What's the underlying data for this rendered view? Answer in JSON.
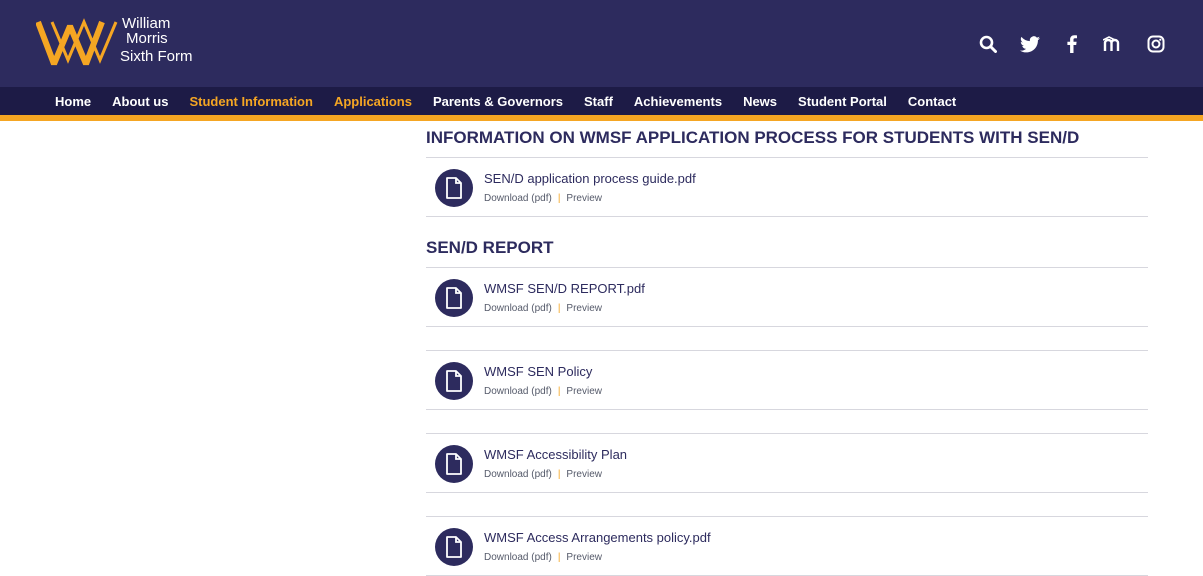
{
  "header": {
    "logo": {
      "line1": "William",
      "line2": "Morris",
      "line3": "Sixth Form"
    },
    "social": [
      "search-icon",
      "twitter-icon",
      "facebook-icon",
      "moodle-icon",
      "instagram-icon"
    ]
  },
  "nav": {
    "items": [
      {
        "label": "Home"
      },
      {
        "label": "About us"
      },
      {
        "label": "Student Information"
      },
      {
        "label": "Applications"
      },
      {
        "label": "Parents & Governors"
      },
      {
        "label": "Staff"
      },
      {
        "label": "Achievements"
      },
      {
        "label": "News"
      },
      {
        "label": "Student Portal"
      },
      {
        "label": "Contact"
      }
    ]
  },
  "sections": [
    {
      "title": "INFORMATION ON WMSF APPLICATION PROCESS FOR STUDENTS WITH SEN/D",
      "files": [
        {
          "name": "SEN/D application process guide.pdf",
          "download": "Download (pdf)",
          "preview": "Preview"
        }
      ]
    },
    {
      "title": "SEN/D REPORT",
      "files": [
        {
          "name": "WMSF SEN/D REPORT.pdf",
          "download": "Download (pdf)",
          "preview": "Preview"
        },
        {
          "name": "WMSF SEN Policy",
          "download": "Download (pdf)",
          "preview": "Preview"
        },
        {
          "name": "WMSF Accessibility Plan",
          "download": "Download (pdf)",
          "preview": "Preview"
        },
        {
          "name": "WMSF Access Arrangements policy.pdf",
          "download": "Download (pdf)",
          "preview": "Preview"
        }
      ]
    }
  ],
  "colors": {
    "navy": "#2d2b5e",
    "nav_dark": "#1d1b46",
    "accent": "#f5a623"
  }
}
